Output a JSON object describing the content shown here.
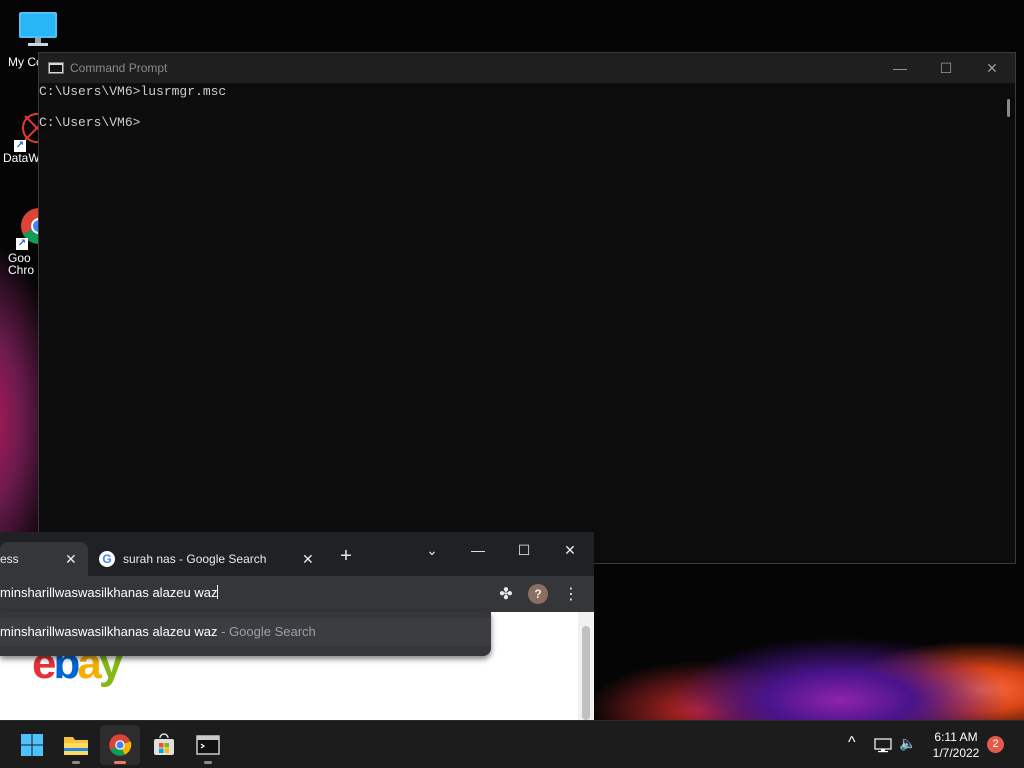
{
  "desktop": {
    "icons": [
      {
        "name": "my-computer-icon",
        "label": "My Co"
      },
      {
        "name": "datawrangler-icon",
        "label": "DataW"
      },
      {
        "name": "google-chrome-desktop-icon",
        "label_line1": "Goo",
        "label_line2": "Chro"
      }
    ]
  },
  "cmd": {
    "title": "Command Prompt",
    "lines": [
      "C:\\Users\\VM6>lusrmgr.msc",
      "",
      "C:\\Users\\VM6>"
    ],
    "controls": {
      "minimize": "—",
      "maximize": "☐",
      "close": "✕"
    }
  },
  "chrome": {
    "tabs": [
      {
        "title": "ess",
        "close": "✕",
        "active": true
      },
      {
        "title": "surah nas - Google Search",
        "close": "✕",
        "active": false
      }
    ],
    "new_tab": "+",
    "tab_search": "⌄",
    "controls": {
      "minimize": "—",
      "maximize": "☐",
      "close": "✕"
    },
    "omnibox_text": "minsharillwaswasilkhanas alazeu waz",
    "suggestion": {
      "query": "minsharillwaswasilkhanas alazeu waz",
      "source": " - Google Search"
    },
    "profile_initial": "?",
    "menu_icon": "⋮",
    "extensions_icon": "✤",
    "page": {
      "logo_letters": [
        "e",
        "b",
        "a",
        "y"
      ],
      "logo_colors": [
        "#e53238",
        "#0064d2",
        "#f5af02",
        "#86b817"
      ]
    }
  },
  "taskbar": {
    "clock_time": "6:11 AM",
    "clock_date": "1/7/2022",
    "notification_count": "2",
    "tray_chevron": "^",
    "volume_icon": "🔈"
  }
}
